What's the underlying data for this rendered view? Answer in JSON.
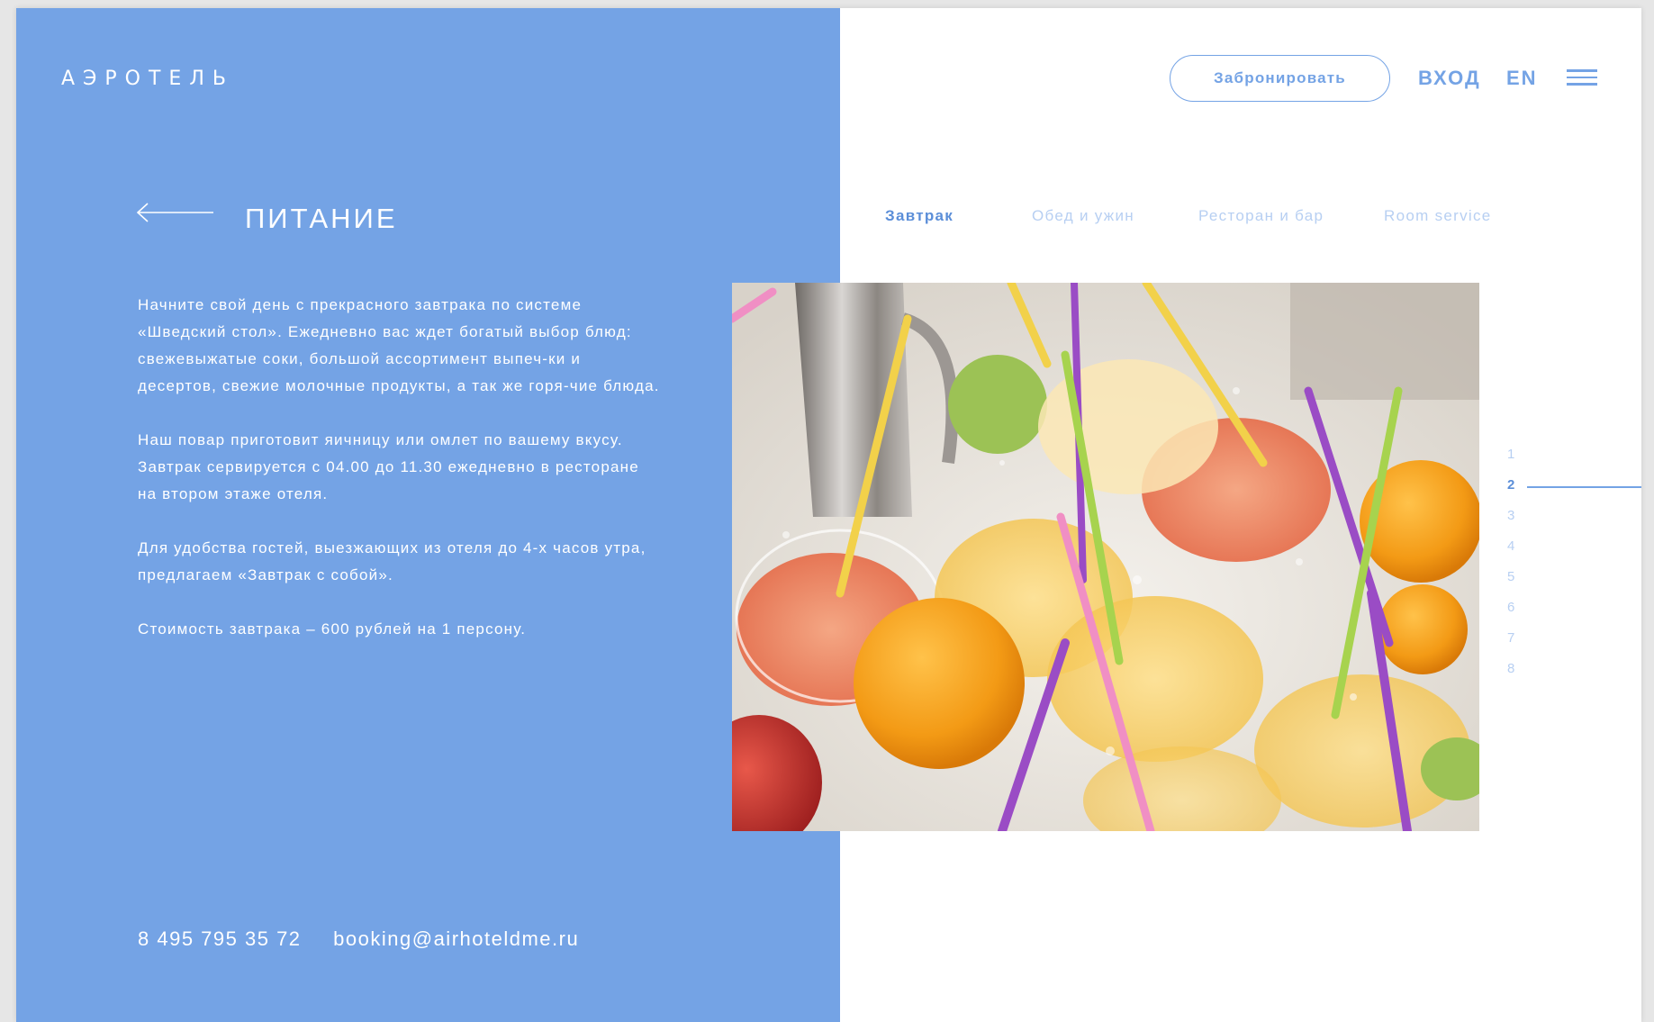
{
  "header": {
    "logo": "АЭРОТЕЛЬ",
    "book_label": "Забронировать",
    "login_label": "ВХОД",
    "lang_label": "EN"
  },
  "section": {
    "title": "ПИТАНИЕ",
    "paragraphs": [
      "Начните свой день с прекрасного завтрака по системе «Шведский стол». Ежедневно вас ждет богатый выбор блюд: свежевыжатые соки, большой ассортимент выпеч-ки и десертов, свежие молочные продукты, а так же горя-чие блюда.",
      "Наш повар приготовит яичницу или омлет по вашему вкусу. Завтрак сервируется с 04.00 до 11.30 ежедневно в ресторане на втором этаже отеля.",
      "Для удобства гостей, выезжающих из отеля до 4-х часов утра, предлагаем «Завтрак с собой».",
      "Стоимость завтрака – 600 рублей на 1 персону."
    ]
  },
  "tabs": [
    {
      "label": "Завтрак",
      "active": true
    },
    {
      "label": "Обед и ужин",
      "active": false
    },
    {
      "label": "Ресторан и бар",
      "active": false
    },
    {
      "label": "Room service",
      "active": false
    }
  ],
  "pager": {
    "pages": [
      "1",
      "2",
      "3",
      "4",
      "5",
      "6",
      "7",
      "8"
    ],
    "current": "2"
  },
  "footer": {
    "phone": "8 495 795 35 72",
    "email": "booking@airhoteldme.ru"
  },
  "colors": {
    "accent": "#74a3e5",
    "accent_dark": "#5b8ed8",
    "muted": "#b7cff2"
  },
  "icons": {
    "back": "arrow-left-icon",
    "menu": "hamburger-menu-icon"
  }
}
